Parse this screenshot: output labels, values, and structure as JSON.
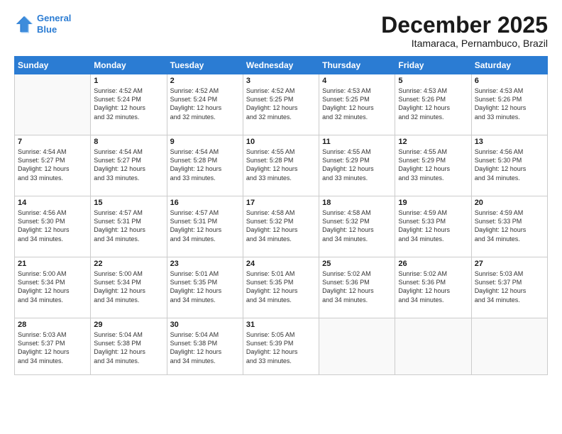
{
  "header": {
    "logo_line1": "General",
    "logo_line2": "Blue",
    "title": "December 2025",
    "subtitle": "Itamaraca, Pernambuco, Brazil"
  },
  "days_of_week": [
    "Sunday",
    "Monday",
    "Tuesday",
    "Wednesday",
    "Thursday",
    "Friday",
    "Saturday"
  ],
  "weeks": [
    [
      {
        "day": "",
        "info": ""
      },
      {
        "day": "1",
        "info": "Sunrise: 4:52 AM\nSunset: 5:24 PM\nDaylight: 12 hours\nand 32 minutes."
      },
      {
        "day": "2",
        "info": "Sunrise: 4:52 AM\nSunset: 5:24 PM\nDaylight: 12 hours\nand 32 minutes."
      },
      {
        "day": "3",
        "info": "Sunrise: 4:52 AM\nSunset: 5:25 PM\nDaylight: 12 hours\nand 32 minutes."
      },
      {
        "day": "4",
        "info": "Sunrise: 4:53 AM\nSunset: 5:25 PM\nDaylight: 12 hours\nand 32 minutes."
      },
      {
        "day": "5",
        "info": "Sunrise: 4:53 AM\nSunset: 5:26 PM\nDaylight: 12 hours\nand 32 minutes."
      },
      {
        "day": "6",
        "info": "Sunrise: 4:53 AM\nSunset: 5:26 PM\nDaylight: 12 hours\nand 33 minutes."
      }
    ],
    [
      {
        "day": "7",
        "info": "Sunrise: 4:54 AM\nSunset: 5:27 PM\nDaylight: 12 hours\nand 33 minutes."
      },
      {
        "day": "8",
        "info": "Sunrise: 4:54 AM\nSunset: 5:27 PM\nDaylight: 12 hours\nand 33 minutes."
      },
      {
        "day": "9",
        "info": "Sunrise: 4:54 AM\nSunset: 5:28 PM\nDaylight: 12 hours\nand 33 minutes."
      },
      {
        "day": "10",
        "info": "Sunrise: 4:55 AM\nSunset: 5:28 PM\nDaylight: 12 hours\nand 33 minutes."
      },
      {
        "day": "11",
        "info": "Sunrise: 4:55 AM\nSunset: 5:29 PM\nDaylight: 12 hours\nand 33 minutes."
      },
      {
        "day": "12",
        "info": "Sunrise: 4:55 AM\nSunset: 5:29 PM\nDaylight: 12 hours\nand 33 minutes."
      },
      {
        "day": "13",
        "info": "Sunrise: 4:56 AM\nSunset: 5:30 PM\nDaylight: 12 hours\nand 34 minutes."
      }
    ],
    [
      {
        "day": "14",
        "info": "Sunrise: 4:56 AM\nSunset: 5:30 PM\nDaylight: 12 hours\nand 34 minutes."
      },
      {
        "day": "15",
        "info": "Sunrise: 4:57 AM\nSunset: 5:31 PM\nDaylight: 12 hours\nand 34 minutes."
      },
      {
        "day": "16",
        "info": "Sunrise: 4:57 AM\nSunset: 5:31 PM\nDaylight: 12 hours\nand 34 minutes."
      },
      {
        "day": "17",
        "info": "Sunrise: 4:58 AM\nSunset: 5:32 PM\nDaylight: 12 hours\nand 34 minutes."
      },
      {
        "day": "18",
        "info": "Sunrise: 4:58 AM\nSunset: 5:32 PM\nDaylight: 12 hours\nand 34 minutes."
      },
      {
        "day": "19",
        "info": "Sunrise: 4:59 AM\nSunset: 5:33 PM\nDaylight: 12 hours\nand 34 minutes."
      },
      {
        "day": "20",
        "info": "Sunrise: 4:59 AM\nSunset: 5:33 PM\nDaylight: 12 hours\nand 34 minutes."
      }
    ],
    [
      {
        "day": "21",
        "info": "Sunrise: 5:00 AM\nSunset: 5:34 PM\nDaylight: 12 hours\nand 34 minutes."
      },
      {
        "day": "22",
        "info": "Sunrise: 5:00 AM\nSunset: 5:34 PM\nDaylight: 12 hours\nand 34 minutes."
      },
      {
        "day": "23",
        "info": "Sunrise: 5:01 AM\nSunset: 5:35 PM\nDaylight: 12 hours\nand 34 minutes."
      },
      {
        "day": "24",
        "info": "Sunrise: 5:01 AM\nSunset: 5:35 PM\nDaylight: 12 hours\nand 34 minutes."
      },
      {
        "day": "25",
        "info": "Sunrise: 5:02 AM\nSunset: 5:36 PM\nDaylight: 12 hours\nand 34 minutes."
      },
      {
        "day": "26",
        "info": "Sunrise: 5:02 AM\nSunset: 5:36 PM\nDaylight: 12 hours\nand 34 minutes."
      },
      {
        "day": "27",
        "info": "Sunrise: 5:03 AM\nSunset: 5:37 PM\nDaylight: 12 hours\nand 34 minutes."
      }
    ],
    [
      {
        "day": "28",
        "info": "Sunrise: 5:03 AM\nSunset: 5:37 PM\nDaylight: 12 hours\nand 34 minutes."
      },
      {
        "day": "29",
        "info": "Sunrise: 5:04 AM\nSunset: 5:38 PM\nDaylight: 12 hours\nand 34 minutes."
      },
      {
        "day": "30",
        "info": "Sunrise: 5:04 AM\nSunset: 5:38 PM\nDaylight: 12 hours\nand 34 minutes."
      },
      {
        "day": "31",
        "info": "Sunrise: 5:05 AM\nSunset: 5:39 PM\nDaylight: 12 hours\nand 33 minutes."
      },
      {
        "day": "",
        "info": ""
      },
      {
        "day": "",
        "info": ""
      },
      {
        "day": "",
        "info": ""
      }
    ]
  ]
}
